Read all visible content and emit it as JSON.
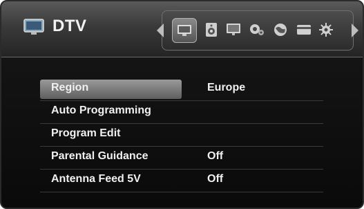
{
  "header": {
    "title": "DTV",
    "icons": [
      {
        "name": "tv-icon",
        "selected": true
      },
      {
        "name": "speaker-icon",
        "selected": false
      },
      {
        "name": "monitor-icon",
        "selected": false
      },
      {
        "name": "gear-icon",
        "selected": false
      },
      {
        "name": "globe-icon",
        "selected": false
      },
      {
        "name": "card-icon",
        "selected": false
      },
      {
        "name": "cog-icon",
        "selected": false
      }
    ]
  },
  "menu": {
    "items": [
      {
        "label": "Region",
        "value": "Europe",
        "selected": true
      },
      {
        "label": "Auto Programming",
        "value": "",
        "selected": false
      },
      {
        "label": "Program Edit",
        "value": "",
        "selected": false
      },
      {
        "label": "Parental Guidance",
        "value": "Off",
        "selected": false
      },
      {
        "label": "Antenna Feed 5V",
        "value": "Off",
        "selected": false
      }
    ]
  }
}
